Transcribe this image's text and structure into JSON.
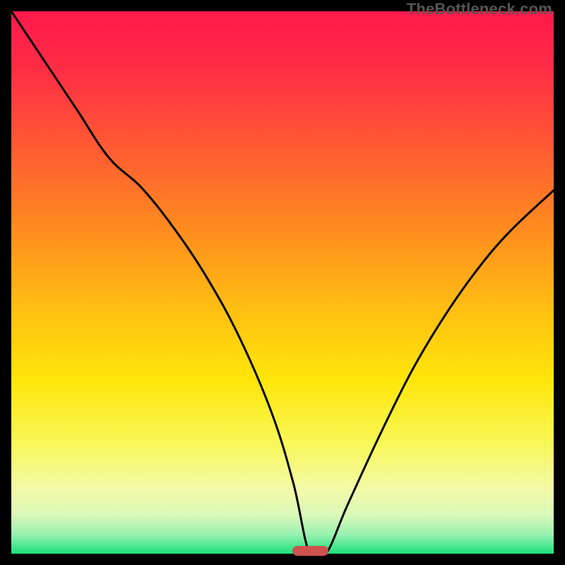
{
  "attribution": "TheBottleneck.com",
  "colors": {
    "frame": "#000000",
    "marker": "#cf524f",
    "curve": "#000000",
    "gradient_stops": [
      {
        "offset": 0.0,
        "color": "#ff1a4b"
      },
      {
        "offset": 0.1,
        "color": "#ff2b45"
      },
      {
        "offset": 0.25,
        "color": "#ff5a33"
      },
      {
        "offset": 0.4,
        "color": "#ff8b1f"
      },
      {
        "offset": 0.55,
        "color": "#ffbf12"
      },
      {
        "offset": 0.68,
        "color": "#ffe60a"
      },
      {
        "offset": 0.8,
        "color": "#f8f85a"
      },
      {
        "offset": 0.88,
        "color": "#f3faa8"
      },
      {
        "offset": 0.93,
        "color": "#d9f8b8"
      },
      {
        "offset": 0.965,
        "color": "#98f0b0"
      },
      {
        "offset": 1.0,
        "color": "#18e07a"
      }
    ]
  },
  "chart_data": {
    "type": "line",
    "title": "",
    "xlabel": "",
    "ylabel": "",
    "xlim": [
      0,
      100
    ],
    "ylim": [
      0,
      100
    ],
    "grid": false,
    "annotations": [
      "TheBottleneck.com"
    ],
    "marker": {
      "x_center": 55.1,
      "width": 6.6,
      "y": 0.5,
      "color": "#cf524f"
    },
    "series": [
      {
        "name": "bottleneck-curve",
        "x": [
          0.0,
          6.0,
          12.0,
          18.0,
          24.0,
          30.0,
          36.0,
          42.0,
          48.0,
          52.0,
          55.0,
          58.0,
          62.0,
          68.0,
          74.0,
          80.0,
          86.0,
          92.0,
          100.0
        ],
        "y": [
          100.0,
          91.0,
          82.0,
          73.0,
          67.5,
          60.0,
          51.0,
          40.0,
          26.0,
          13.0,
          0.0,
          0.0,
          9.0,
          22.0,
          34.0,
          44.0,
          52.5,
          59.5,
          67.0
        ]
      }
    ]
  }
}
